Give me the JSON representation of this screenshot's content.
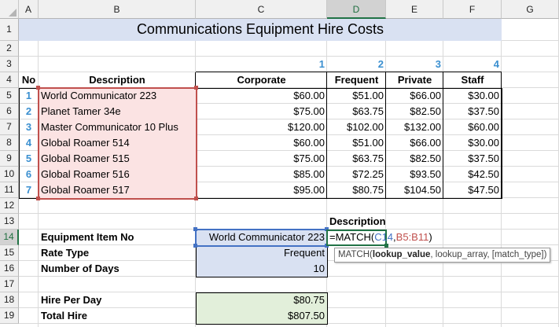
{
  "columns": [
    "A",
    "B",
    "C",
    "D",
    "E",
    "F",
    "G"
  ],
  "rows": [
    "1",
    "2",
    "3",
    "4",
    "5",
    "6",
    "7",
    "8",
    "9",
    "10",
    "11",
    "12",
    "13",
    "14",
    "15",
    "16",
    "17",
    "18",
    "19"
  ],
  "title": "Communications Equipment Hire Costs",
  "rate_indices": [
    "1",
    "2",
    "3",
    "4"
  ],
  "headers": {
    "no": "No",
    "description": "Description",
    "corporate": "Corporate",
    "frequent": "Frequent",
    "private": "Private",
    "staff": "Staff"
  },
  "items": [
    {
      "no": "1",
      "description": "World Communicator 223",
      "corporate": "$60.00",
      "frequent": "$51.00",
      "private": "$66.00",
      "staff": "$30.00"
    },
    {
      "no": "2",
      "description": "Planet Tamer 34e",
      "corporate": "$75.00",
      "frequent": "$63.75",
      "private": "$82.50",
      "staff": "$37.50"
    },
    {
      "no": "3",
      "description": "Master Communicator 10 Plus",
      "corporate": "$120.00",
      "frequent": "$102.00",
      "private": "$132.00",
      "staff": "$60.00"
    },
    {
      "no": "4",
      "description": "Global Roamer 514",
      "corporate": "$60.00",
      "frequent": "$51.00",
      "private": "$66.00",
      "staff": "$30.00"
    },
    {
      "no": "5",
      "description": "Global Roamer 515",
      "corporate": "$75.00",
      "frequent": "$63.75",
      "private": "$82.50",
      "staff": "$37.50"
    },
    {
      "no": "6",
      "description": "Global Roamer 516",
      "corporate": "$85.00",
      "frequent": "$72.25",
      "private": "$93.50",
      "staff": "$42.50"
    },
    {
      "no": "7",
      "description": "Global Roamer 517",
      "corporate": "$95.00",
      "frequent": "$80.75",
      "private": "$104.50",
      "staff": "$47.50"
    }
  ],
  "lookup": {
    "description_label": "Description",
    "equipment_label": "Equipment Item No",
    "equipment_value": "World Communicator 223",
    "rate_label": "Rate Type",
    "rate_value": "Frequent",
    "days_label": "Number of Days",
    "days_value": "10",
    "hire_day_label": "Hire Per Day",
    "hire_day_value": "$80.75",
    "total_label": "Total Hire",
    "total_value": "$807.50"
  },
  "formula": {
    "prefix": "=MATCH(",
    "ref1": "C14",
    "sep": ",",
    "ref2": "B5:B11",
    "suffix": ")"
  },
  "tooltip": {
    "fn": "MATCH(",
    "arg1": "lookup_value",
    "rest": ", lookup_array, [match_type])"
  },
  "colors": {
    "ref1": "#4472c4",
    "ref2": "#c0504d",
    "title_fill": "#d9e1f2",
    "accent": "#217346"
  }
}
